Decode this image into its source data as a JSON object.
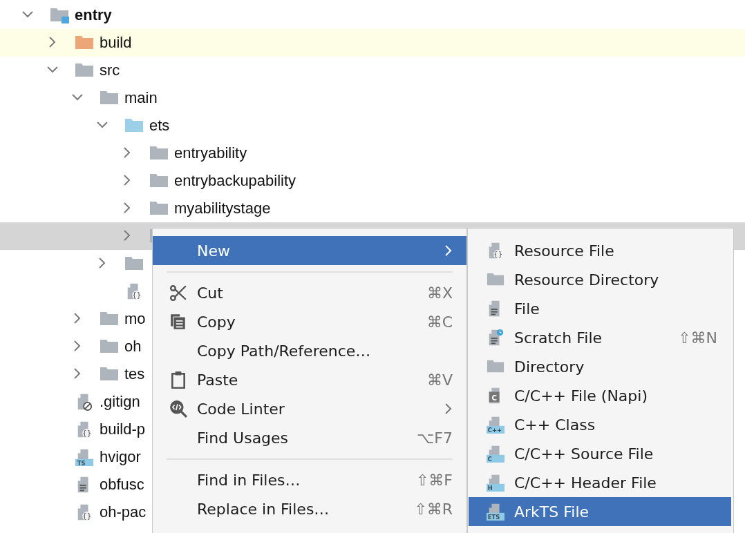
{
  "tree": [
    {
      "label": "entry",
      "kind": "module",
      "expanded": true,
      "selected": false,
      "children": [
        {
          "label": "build",
          "kind": "excluded-folder",
          "expanded": false,
          "selected": false
        },
        {
          "label": "src",
          "kind": "folder",
          "expanded": true,
          "selected": false,
          "children": [
            {
              "label": "main",
              "kind": "folder",
              "expanded": true,
              "selected": false,
              "children": [
                {
                  "label": "ets",
                  "kind": "source-folder",
                  "expanded": true,
                  "selected": false,
                  "children": [
                    {
                      "label": "entryability",
                      "kind": "folder",
                      "expanded": false,
                      "selected": false
                    },
                    {
                      "label": "entrybackupability",
                      "kind": "folder",
                      "expanded": false,
                      "selected": false
                    },
                    {
                      "label": "myabilitystage",
                      "kind": "folder",
                      "expanded": false,
                      "selected": false
                    },
                    {
                      "kind": "folder",
                      "expanded": false,
                      "selected": true
                    }
                  ]
                },
                {
                  "kind": "folder",
                  "expanded": false,
                  "selected": false
                },
                {
                  "kind": "json-file",
                  "badge": "{}",
                  "selected": false
                }
              ]
            },
            {
              "label": "mo",
              "kind": "folder",
              "expanded": false,
              "selected": false
            },
            {
              "label": "oh",
              "kind": "folder",
              "expanded": false,
              "selected": false
            },
            {
              "label": "tes",
              "kind": "folder",
              "expanded": false,
              "selected": false
            }
          ]
        },
        {
          "label": ".gitign",
          "kind": "ignore-file",
          "selected": false
        },
        {
          "label": "build-p",
          "kind": "json-file",
          "badge": "{}",
          "selected": false
        },
        {
          "label": "hvigor",
          "kind": "ts-file",
          "badge": "TS",
          "selected": false
        },
        {
          "label": "obfusc",
          "kind": "text-file",
          "selected": false
        },
        {
          "label": "oh-pac",
          "kind": "json-file",
          "badge": "{}",
          "selected": false
        }
      ]
    }
  ],
  "context_menu": {
    "groups": [
      [
        {
          "label": "New",
          "kind": "plain",
          "submenu": true,
          "selected": true
        }
      ],
      [
        {
          "label": "Cut",
          "kind": "cut",
          "shortcut": "⌘X",
          "selected": false
        },
        {
          "label": "Copy",
          "kind": "copy",
          "shortcut": "⌘C",
          "selected": false
        },
        {
          "label": "Copy Path/Reference…",
          "kind": "plain",
          "selected": false
        },
        {
          "label": "Paste",
          "kind": "paste",
          "shortcut": "⌘V",
          "selected": false
        },
        {
          "label": "Code Linter",
          "kind": "linter",
          "submenu": true,
          "selected": false
        },
        {
          "label": "Find Usages",
          "kind": "plain",
          "shortcut": "⌥F7",
          "selected": false
        }
      ],
      [
        {
          "label": "Find in Files…",
          "kind": "plain",
          "shortcut": "⇧⌘F",
          "selected": false
        },
        {
          "label": "Replace in Files…",
          "kind": "plain",
          "shortcut": "⇧⌘R",
          "selected": false
        }
      ]
    ]
  },
  "submenu": {
    "items": [
      {
        "label": "Resource File",
        "kind": "json-file",
        "badge": "{}",
        "selected": false
      },
      {
        "label": "Resource Directory",
        "kind": "folder",
        "selected": false
      },
      {
        "label": "File",
        "kind": "text-file",
        "selected": false
      },
      {
        "label": "Scratch File",
        "kind": "scratch-file",
        "shortcut": "⇧⌘N",
        "selected": false
      },
      {
        "label": "Directory",
        "kind": "folder",
        "selected": false
      },
      {
        "label": "C/C++ File (Napi)",
        "kind": "c-napi",
        "badge": "C",
        "selected": false
      },
      {
        "label": "C++ Class",
        "kind": "badged-file",
        "badge": "C++",
        "selected": false
      },
      {
        "label": "C/C++ Source File",
        "kind": "badged-file",
        "badge": "C",
        "selected": false
      },
      {
        "label": "C/C++ Header File",
        "kind": "badged-file",
        "badge": "H",
        "selected": false
      },
      {
        "label": "ArkTS File",
        "kind": "badged-file",
        "badge": "ETS",
        "selected": true
      }
    ]
  }
}
